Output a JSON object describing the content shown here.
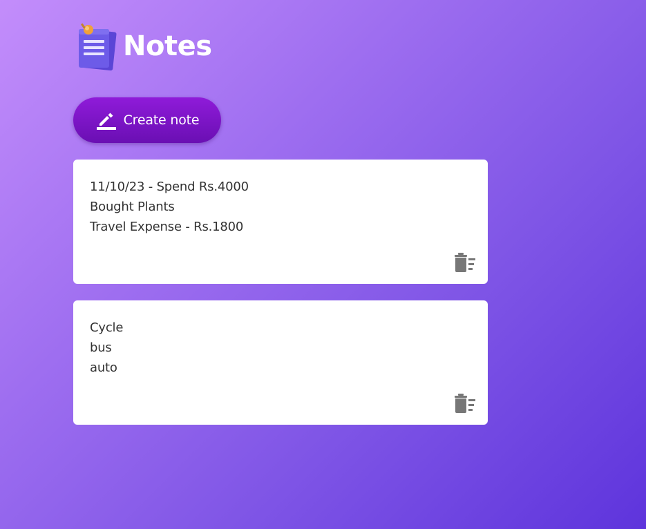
{
  "header": {
    "title": "Notes",
    "logo_icon": "notepad-pin-icon"
  },
  "create_button": {
    "label": "Create note",
    "icon": "pencil-edit-icon"
  },
  "notes": [
    {
      "lines": [
        "11/10/23 - Spend Rs.4000",
        "Bought Plants",
        "Travel Expense - Rs.1800"
      ],
      "delete_icon": "delete-sweep-icon"
    },
    {
      "lines": [
        "Cycle",
        "bus",
        "auto"
      ],
      "delete_icon": "delete-sweep-icon"
    }
  ],
  "colors": {
    "background_start": "#c38dfb",
    "background_end": "#5e34dc",
    "button": "#7a15c6",
    "card": "#ffffff",
    "note_text": "#333333",
    "delete_icon": "#777777"
  }
}
